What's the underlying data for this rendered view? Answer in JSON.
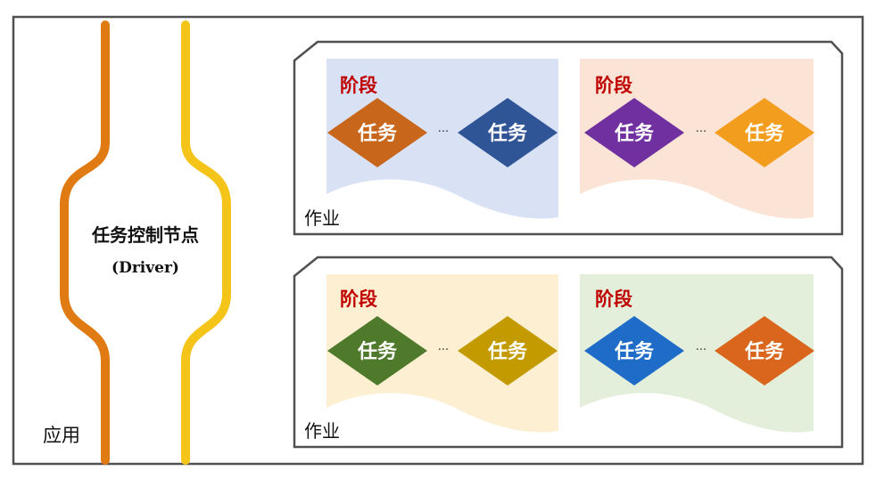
{
  "app": {
    "label": "应用",
    "driver_line1": "任务控制节点",
    "driver_line2": "(Driver)"
  },
  "colors": {
    "pipe_orange": "#e07b14",
    "pipe_yellow": "#f5c418",
    "stage_title": "#c00000",
    "frame": "#505050"
  },
  "jobs": [
    {
      "label": "作业",
      "stages": [
        {
          "title": "阶段",
          "bg": "#d9e2f5",
          "tasks": [
            {
              "label": "任务",
              "color": "#c8661c"
            },
            {
              "label": "任务",
              "color": "#2f5597"
            }
          ],
          "ellipsis": "···"
        },
        {
          "title": "阶段",
          "bg": "#fbe4d6",
          "tasks": [
            {
              "label": "任务",
              "color": "#7030a0"
            },
            {
              "label": "任务",
              "color": "#f29d1e"
            }
          ],
          "ellipsis": "···"
        }
      ]
    },
    {
      "label": "作业",
      "stages": [
        {
          "title": "阶段",
          "bg": "#fdf0d2",
          "tasks": [
            {
              "label": "任务",
              "color": "#4f7a2c"
            },
            {
              "label": "任务",
              "color": "#c39a00"
            }
          ],
          "ellipsis": "···"
        },
        {
          "title": "阶段",
          "bg": "#e3efda",
          "tasks": [
            {
              "label": "任务",
              "color": "#1f6cc8"
            },
            {
              "label": "任务",
              "color": "#d9661c"
            }
          ],
          "ellipsis": "···"
        }
      ]
    }
  ]
}
